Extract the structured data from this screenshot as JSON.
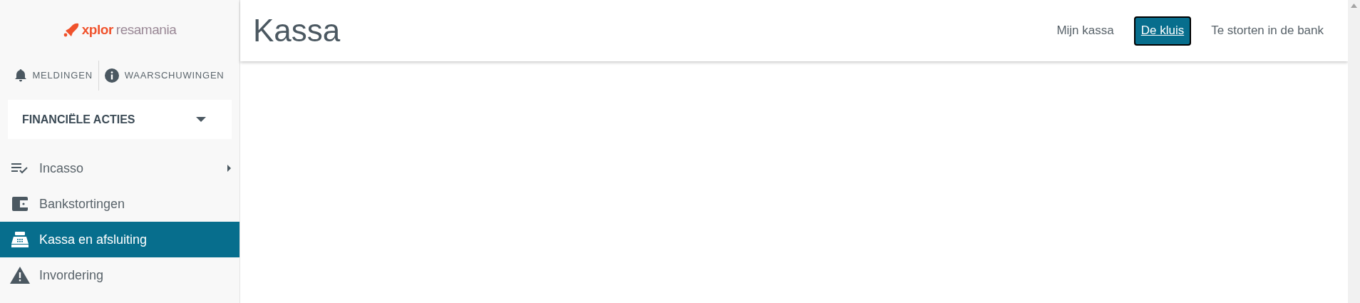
{
  "logo": {
    "brand": "xplor",
    "product": "resamania"
  },
  "notifications": [
    {
      "kind": "bell",
      "label": "MELDINGEN"
    },
    {
      "kind": "info",
      "label": "WAARSCHUWINGEN"
    }
  ],
  "section": {
    "title": "FINANCIËLE ACTIES",
    "expanded": true
  },
  "sidebar": {
    "items": [
      {
        "kind": "checklist",
        "label": "Incasso",
        "selected": false,
        "submenu": true
      },
      {
        "kind": "wallet",
        "label": "Bankstortingen",
        "selected": false,
        "submenu": false
      },
      {
        "kind": "register",
        "label": "Kassa en afsluiting",
        "selected": true,
        "submenu": false
      },
      {
        "kind": "warning",
        "label": "Invordering",
        "selected": false,
        "submenu": false
      }
    ]
  },
  "page": {
    "title": "Kassa"
  },
  "tabs": [
    {
      "label": "Mijn kassa",
      "selected": false
    },
    {
      "label": "De kluis",
      "selected": true
    },
    {
      "label": "Te storten in de bank",
      "selected": false
    }
  ]
}
